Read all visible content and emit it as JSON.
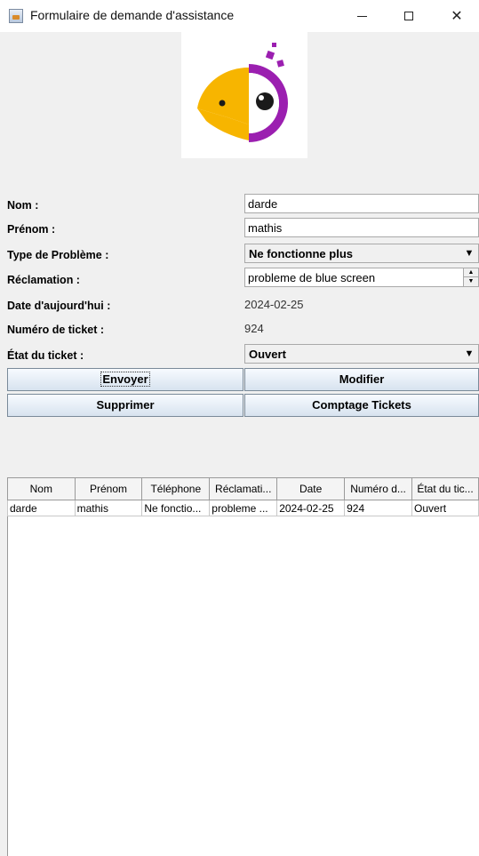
{
  "window": {
    "title": "Formulaire de demande d'assistance",
    "controls": {
      "minimize": "—",
      "maximize": "",
      "close": "✕"
    }
  },
  "form": {
    "nom": {
      "label": "Nom :",
      "value": "darde"
    },
    "prenom": {
      "label": "Prénom :",
      "value": "mathis"
    },
    "type_probleme": {
      "label": "Type de Problème :",
      "value": "Ne fonctionne plus"
    },
    "reclamation": {
      "label": "Réclamation :",
      "value": "probleme de blue screen"
    },
    "date": {
      "label": "Date d'aujourd'hui :",
      "value": "2024-02-25"
    },
    "numero": {
      "label": "Numéro de ticket :",
      "value": "924"
    },
    "etat": {
      "label": "État du ticket :",
      "value": "Ouvert"
    }
  },
  "buttons": {
    "envoyer": "Envoyer",
    "modifier": "Modifier",
    "supprimer": "Supprimer",
    "comptage": "Comptage Tickets"
  },
  "table": {
    "headers": [
      "Nom",
      "Prénom",
      "Téléphone",
      "Réclamati...",
      "Date",
      "Numéro d...",
      "État du tic..."
    ],
    "rows": [
      [
        "darde",
        "mathis",
        "Ne fonctio...",
        "probleme ...",
        "2024-02-25",
        "924",
        "Ouvert"
      ]
    ]
  },
  "logo": {
    "icon": "parrot-logo-icon",
    "colors": {
      "yellow": "#f7b500",
      "purple": "#9b1fb0",
      "dark": "#1a1a1a"
    }
  }
}
